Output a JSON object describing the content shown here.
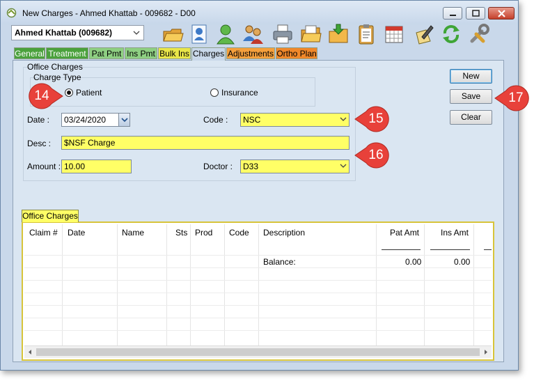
{
  "window": {
    "title": "New Charges - Ahmed Khattab - 009682 - D00"
  },
  "patient_selector": {
    "value": "Ahmed Khattab (009682)"
  },
  "tabs": [
    {
      "label": "General"
    },
    {
      "label": "Treatment"
    },
    {
      "label": "Pat Pmt"
    },
    {
      "label": "Ins Pmt"
    },
    {
      "label": "Bulk Ins"
    },
    {
      "label": "Charges"
    },
    {
      "label": "Adjustments"
    },
    {
      "label": "Ortho Plan"
    }
  ],
  "active_tab": "Charges",
  "form": {
    "group_title": "Office Charges",
    "charge_type": {
      "title": "Charge Type",
      "options": [
        "Patient",
        "Insurance"
      ],
      "selected": "Patient"
    },
    "date": {
      "label": "Date :",
      "value": "03/24/2020"
    },
    "code": {
      "label": "Code :",
      "value": "NSC"
    },
    "desc": {
      "label": "Desc :",
      "value": "$NSF Charge"
    },
    "amount": {
      "label": "Amount :",
      "value": "10.00"
    },
    "doctor": {
      "label": "Doctor :",
      "value": "D33"
    }
  },
  "buttons": {
    "new": "New",
    "save": "Save",
    "clear": "Clear"
  },
  "callouts": [
    "14",
    "15",
    "16",
    "17"
  ],
  "grid": {
    "tab_label": "Office Charges",
    "columns": [
      "Claim #",
      "Date",
      "Name",
      "Sts",
      "Prod",
      "Code",
      "Description",
      "Pat Amt",
      "Ins Amt"
    ],
    "balance_label": "Balance:",
    "balance_pat": "0.00",
    "balance_ins": "0.00"
  },
  "colors": {
    "required_field": "#ffff66",
    "callout": "#e8413a",
    "window_bg": "#c9d8ea"
  }
}
